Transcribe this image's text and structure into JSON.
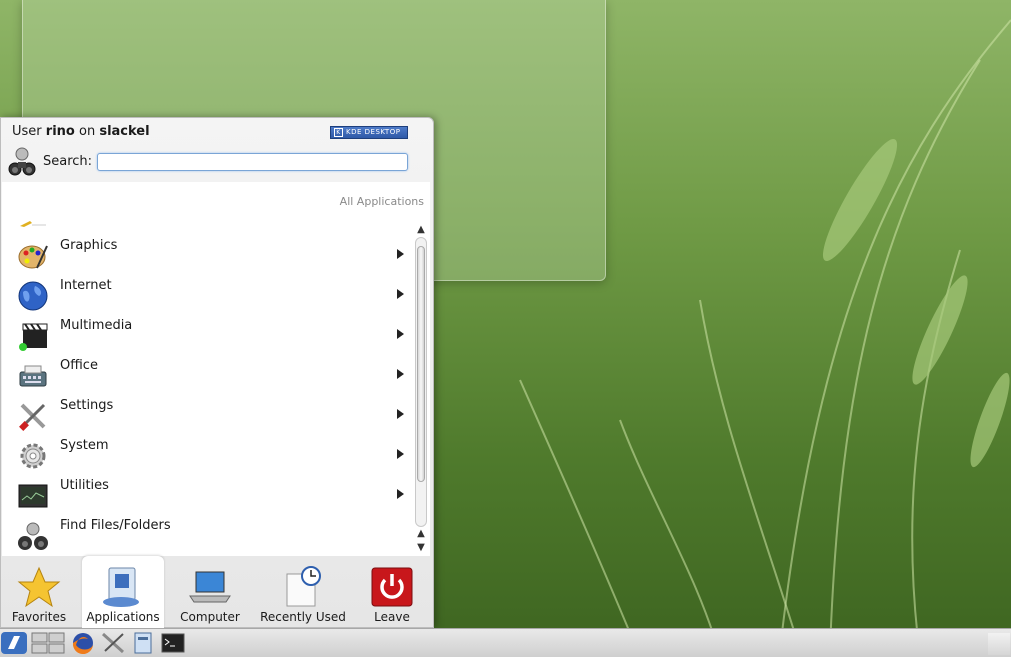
{
  "menu": {
    "user_prefix": "User",
    "user_name": "rino",
    "host_prefix": "on",
    "host_name": "slackel",
    "badge_text": "KDE DESKTOP",
    "search_label": "Search:",
    "search_value": "",
    "breadcrumb": "All Applications",
    "items": [
      {
        "label": "Graphics",
        "icon": "palette-icon",
        "has_submenu": true
      },
      {
        "label": "Internet",
        "icon": "globe-icon",
        "has_submenu": true
      },
      {
        "label": "Multimedia",
        "icon": "clapperboard-icon",
        "has_submenu": true
      },
      {
        "label": "Office",
        "icon": "typewriter-icon",
        "has_submenu": true
      },
      {
        "label": "Settings",
        "icon": "tools-icon",
        "has_submenu": true
      },
      {
        "label": "System",
        "icon": "gear-icon",
        "has_submenu": true
      },
      {
        "label": "Utilities",
        "icon": "monitor-icon",
        "has_submenu": true
      },
      {
        "label": "Find Files/Folders",
        "icon": "binoculars-icon",
        "has_submenu": false
      }
    ],
    "tabs": [
      {
        "label": "Favorites",
        "icon": "star-icon"
      },
      {
        "label": "Applications",
        "icon": "applications-icon",
        "active": true
      },
      {
        "label": "Computer",
        "icon": "laptop-icon"
      },
      {
        "label": "Recently Used",
        "icon": "clock-document-icon"
      },
      {
        "label": "Leave",
        "icon": "power-icon"
      }
    ]
  },
  "taskbar": {
    "items": [
      "kickoff-launcher-icon",
      "pager-icon",
      "firefox-icon",
      "settings-tools-icon",
      "file-manager-icon",
      "terminal-icon"
    ]
  },
  "colors": {
    "accent": "#3a6fbf",
    "leave_red": "#c8171b",
    "desktop_green": "#6f9a45"
  }
}
